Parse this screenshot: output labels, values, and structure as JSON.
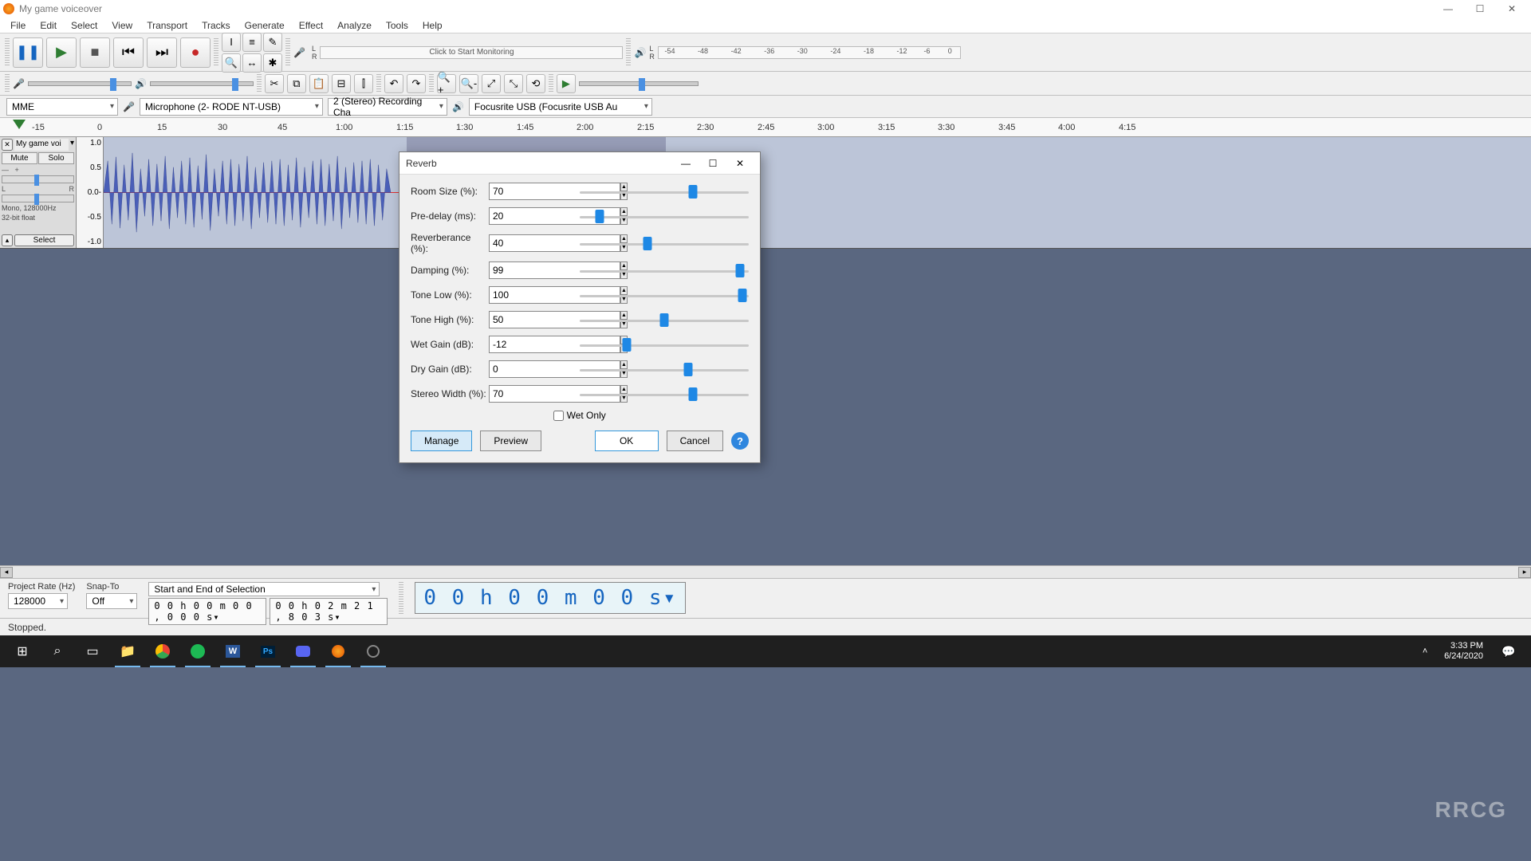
{
  "window": {
    "title": "My game voiceover"
  },
  "menu": [
    "File",
    "Edit",
    "Select",
    "View",
    "Transport",
    "Tracks",
    "Generate",
    "Effect",
    "Analyze",
    "Tools",
    "Help"
  ],
  "transport": {
    "pause": "❚❚",
    "play": "▶",
    "stop": "■",
    "start": "⏮",
    "end": "⏭",
    "rec": "●"
  },
  "meters": {
    "rec_hint": "Click to Start Monitoring",
    "ticks": [
      "-54",
      "-48",
      "-42",
      "-36",
      "-30",
      "-24",
      "-18",
      "-12",
      "-6",
      "0"
    ]
  },
  "devices": {
    "host": "MME",
    "input": "Microphone (2- RODE NT-USB)",
    "channels": "2 (Stereo) Recording Cha",
    "output": "Focusrite USB (Focusrite USB Au"
  },
  "ruler": [
    "-15",
    "0",
    "15",
    "30",
    "45",
    "1:00",
    "1:15",
    "1:30",
    "1:45",
    "2:00",
    "2:15",
    "2:30",
    "2:45",
    "3:00",
    "3:15",
    "3:30",
    "3:45",
    "4:00",
    "4:15"
  ],
  "track": {
    "name": "My game voi",
    "mute": "Mute",
    "solo": "Solo",
    "info1": "Mono, 128000Hz",
    "info2": "32-bit float",
    "select": "Select",
    "scale": [
      "1.0",
      "0.5",
      "0.0-",
      "-0.5",
      "-1.0"
    ]
  },
  "selection": {
    "rate_lbl": "Project Rate (Hz)",
    "rate": "128000",
    "snap_lbl": "Snap-To",
    "snap": "Off",
    "mode": "Start and End of Selection",
    "start": "0 0 h 0 0 m 0 0 , 0 0 0 s▾",
    "end": "0 0 h 0 2 m 2 1 , 8 0 3 s▾",
    "bigtime": "0 0 h 0 0 m 0 0 s▾"
  },
  "status": "Stopped.",
  "dialog": {
    "title": "Reverb",
    "params": [
      {
        "label": "Room Size (%):",
        "value": "70",
        "pos": 67
      },
      {
        "label": "Pre-delay (ms):",
        "value": "20",
        "pos": 12
      },
      {
        "label": "Reverberance (%):",
        "value": "40",
        "pos": 40
      },
      {
        "label": "Damping (%):",
        "value": "99",
        "pos": 95
      },
      {
        "label": "Tone Low (%):",
        "value": "100",
        "pos": 96
      },
      {
        "label": "Tone High (%):",
        "value": "50",
        "pos": 50
      },
      {
        "label": "Wet Gain (dB):",
        "value": "-12",
        "pos": 28
      },
      {
        "label": "Dry Gain (dB):",
        "value": "0",
        "pos": 64
      },
      {
        "label": "Stereo Width (%):",
        "value": "70",
        "pos": 67
      }
    ],
    "wetonly": "Wet Only",
    "buttons": {
      "manage": "Manage",
      "preview": "Preview",
      "ok": "OK",
      "cancel": "Cancel"
    }
  },
  "taskbar": {
    "time": "3:33 PM",
    "date": "6/24/2020"
  },
  "brand": "RRCG"
}
